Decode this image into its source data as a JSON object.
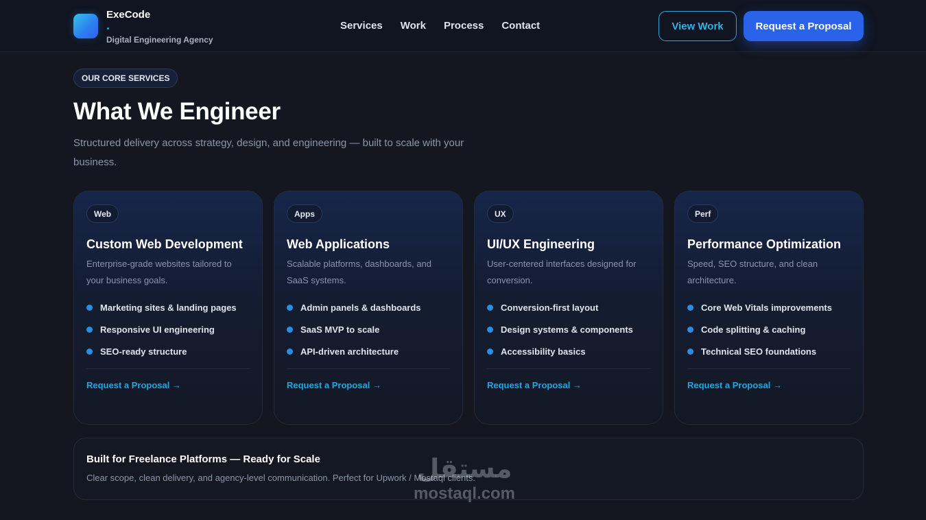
{
  "header": {
    "brand": {
      "name": "ExeCode",
      "tagline": "Digital Engineering Agency"
    },
    "nav": [
      "Services",
      "Work",
      "Process",
      "Contact"
    ],
    "buttons": {
      "view_work": "View Work",
      "request": "Request a Proposal"
    }
  },
  "section": {
    "eyebrow": "OUR CORE SERVICES",
    "title": "What We Engineer",
    "lead": "Structured delivery across strategy, design, and engineering — built to scale with your business."
  },
  "cards": [
    {
      "tag": "Web",
      "title": "Custom Web Development",
      "desc": "Enterprise-grade websites tailored to your business goals.",
      "items": [
        "Marketing sites & landing pages",
        "Responsive UI engineering",
        "SEO-ready structure"
      ],
      "cta": "Request a Proposal →"
    },
    {
      "tag": "Apps",
      "title": "Web Applications",
      "desc": "Scalable platforms, dashboards, and SaaS systems.",
      "items": [
        "Admin panels & dashboards",
        "SaaS MVP to scale",
        "API-driven architecture"
      ],
      "cta": "Request a Proposal →"
    },
    {
      "tag": "UX",
      "title": "UI/UX Engineering",
      "desc": "User-centered interfaces designed for conversion.",
      "items": [
        "Conversion-first layout",
        "Design systems & components",
        "Accessibility basics"
      ],
      "cta": "Request a Proposal →"
    },
    {
      "tag": "Perf",
      "title": "Performance Optimization",
      "desc": "Speed, SEO structure, and clean architecture.",
      "items": [
        "Core Web Vitals improvements",
        "Code splitting & caching",
        "Technical SEO foundations"
      ],
      "cta": "Request a Proposal →"
    }
  ],
  "banner": {
    "title": "Built for Freelance Platforms — Ready for Scale",
    "text": "Clear scope, clean delivery, and agency-level communication. Perfect for Upwork / Mostaql clients."
  },
  "watermark": {
    "arabic": "مستقل",
    "latin": "mostaql.com"
  },
  "colors": {
    "accent": "#2a62ea",
    "link": "#1fa8e0",
    "background": "#14171f"
  }
}
